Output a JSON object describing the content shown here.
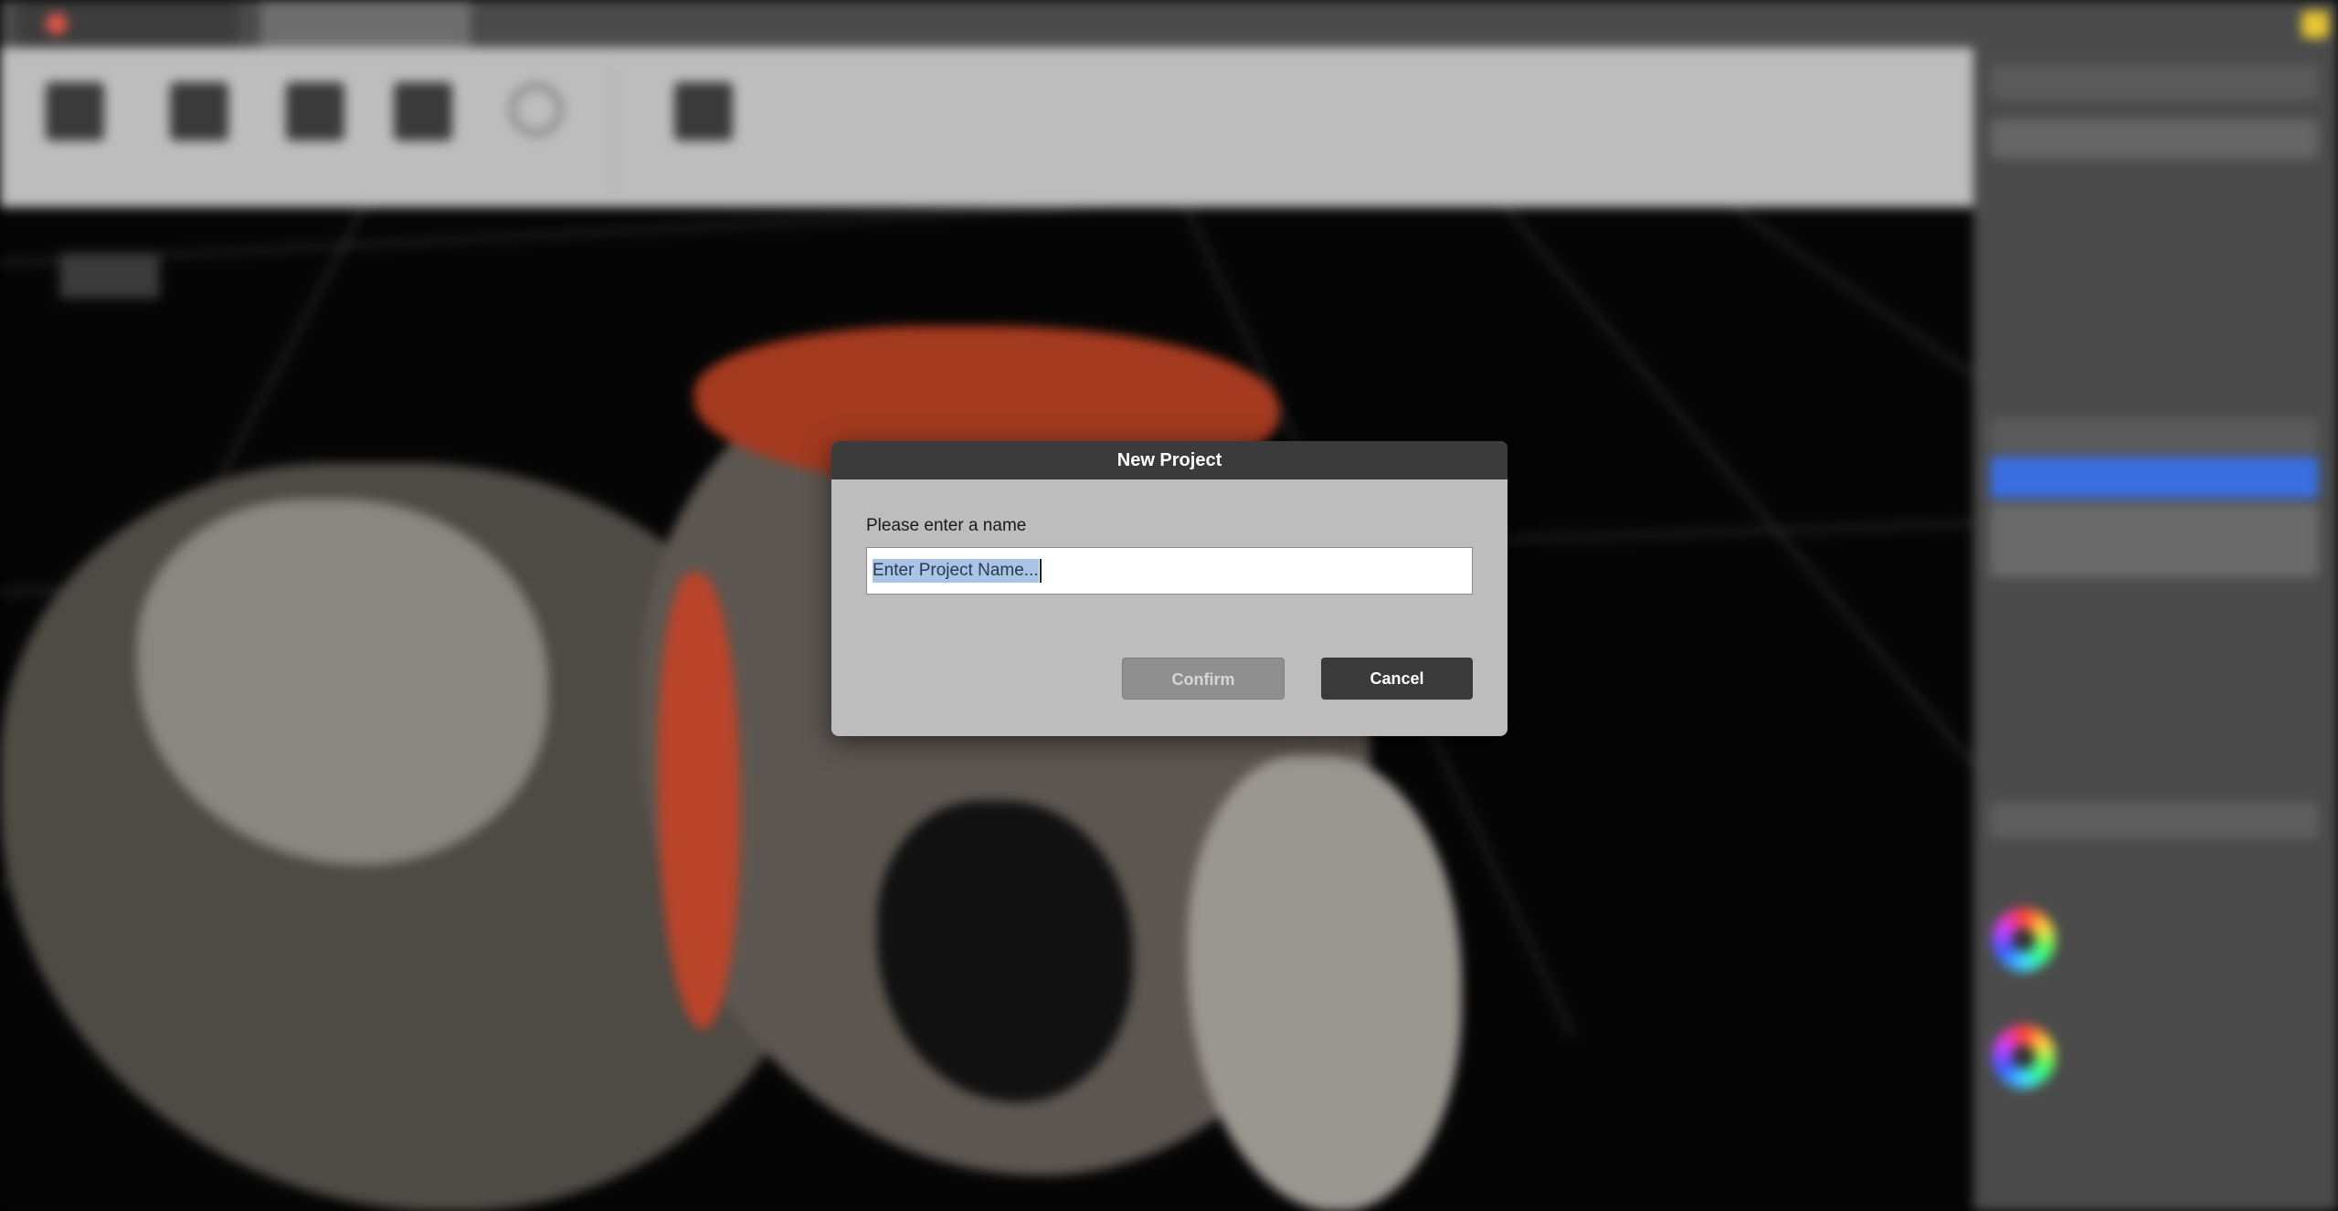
{
  "dialog": {
    "title": "New Project",
    "prompt": "Please enter a name",
    "input_value": "Enter Project Name...",
    "confirm_label": "Confirm",
    "cancel_label": "Cancel",
    "confirm_enabled": false
  },
  "colors": {
    "dialog_bg": "#bdbdbd",
    "title_bar": "#3b3b3b",
    "selection": "#aac4e6",
    "accent_blue": "#3a6fe0",
    "app_bg": "#4a4a4a"
  },
  "icons": [
    "app-logo-icon",
    "user-icon",
    "gear-icon",
    "color-wheel-icon"
  ]
}
